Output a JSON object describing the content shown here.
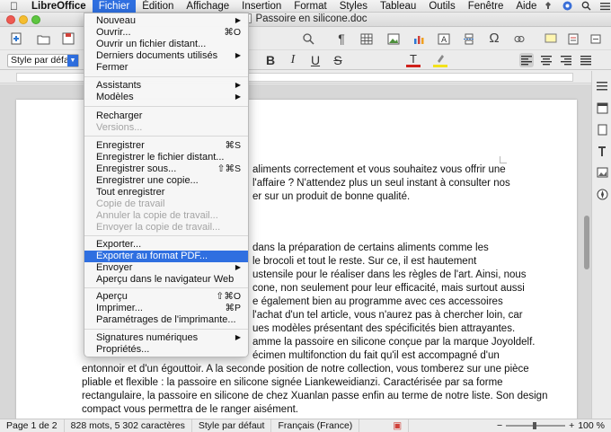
{
  "menubar": {
    "app_name": "LibreOffice",
    "items": [
      "Fichier",
      "Édition",
      "Affichage",
      "Insertion",
      "Format",
      "Styles",
      "Tableau",
      "Outils",
      "Fenêtre",
      "Aide"
    ]
  },
  "window": {
    "title": "Passoire en silicone.doc"
  },
  "toolbar": {
    "paragraph_style": "Style par défaut",
    "bold_label": "B",
    "italic_label": "I",
    "underline_label": "U",
    "font_color_label": "T",
    "strike_label": "S"
  },
  "file_menu": {
    "items": [
      {
        "label": "Nouveau",
        "shortcut": "",
        "submenu": true,
        "disabled": false
      },
      {
        "label": "Ouvrir...",
        "shortcut": "⌘O",
        "submenu": false,
        "disabled": false
      },
      {
        "label": "Ouvrir un fichier distant...",
        "shortcut": "",
        "submenu": false,
        "disabled": false
      },
      {
        "label": "Derniers documents utilisés",
        "shortcut": "",
        "submenu": true,
        "disabled": false
      },
      {
        "label": "Fermer",
        "shortcut": "",
        "submenu": false,
        "disabled": false
      },
      {
        "label": "Assistants",
        "shortcut": "",
        "submenu": true,
        "disabled": false
      },
      {
        "label": "Modèles",
        "shortcut": "",
        "submenu": true,
        "disabled": false
      },
      {
        "label": "Recharger",
        "shortcut": "",
        "submenu": false,
        "disabled": false
      },
      {
        "label": "Versions...",
        "shortcut": "",
        "submenu": false,
        "disabled": true
      },
      {
        "label": "Enregistrer",
        "shortcut": "⌘S",
        "submenu": false,
        "disabled": false
      },
      {
        "label": "Enregistrer le fichier distant...",
        "shortcut": "",
        "submenu": false,
        "disabled": false
      },
      {
        "label": "Enregistrer sous...",
        "shortcut": "⇧⌘S",
        "submenu": false,
        "disabled": false
      },
      {
        "label": "Enregistrer une copie...",
        "shortcut": "",
        "submenu": false,
        "disabled": false
      },
      {
        "label": "Tout enregistrer",
        "shortcut": "",
        "submenu": false,
        "disabled": false
      },
      {
        "label": "Copie de travail",
        "shortcut": "",
        "submenu": false,
        "disabled": true
      },
      {
        "label": "Annuler la copie de travail...",
        "shortcut": "",
        "submenu": false,
        "disabled": true
      },
      {
        "label": "Envoyer la copie de travail...",
        "shortcut": "",
        "submenu": false,
        "disabled": true
      },
      {
        "label": "Exporter...",
        "shortcut": "",
        "submenu": false,
        "disabled": false
      },
      {
        "label": "Exporter au format PDF...",
        "shortcut": "",
        "submenu": false,
        "disabled": false,
        "highlighted": true
      },
      {
        "label": "Envoyer",
        "shortcut": "",
        "submenu": true,
        "disabled": false
      },
      {
        "label": "Aperçu dans le navigateur Web",
        "shortcut": "",
        "submenu": false,
        "disabled": false
      },
      {
        "label": "Aperçu",
        "shortcut": "⇧⌘O",
        "submenu": false,
        "disabled": false
      },
      {
        "label": "Imprimer...",
        "shortcut": "⌘P",
        "submenu": false,
        "disabled": false
      },
      {
        "label": "Paramétrages de l'imprimante...",
        "shortcut": "",
        "submenu": false,
        "disabled": false
      },
      {
        "label": "Signatures numériques",
        "shortcut": "",
        "submenu": true,
        "disabled": false
      },
      {
        "label": "Propriétés...",
        "shortcut": "",
        "submenu": false,
        "disabled": false
      }
    ]
  },
  "document": {
    "lines_top": [
      "aliments correctement et vous souhaitez vous offrir une",
      "l'affaire ? N'attendez plus un seul instant à consulter nos",
      "er sur un produit de bonne qualité."
    ],
    "lines_mid": [
      "dans la préparation de certains aliments comme les",
      "le brocoli et tout le reste. Sur ce, il est hautement",
      "ustensile pour le réaliser dans les règles de l'art. Ainsi, nous",
      "cone, non seulement pour leur efficacité, mais surtout aussi",
      "e également bien au programme avec ces accessoires",
      "l'achat d'un tel article, vous n'aurez pas à chercher loin, car",
      "ues modèles présentant des spécificités bien attrayantes.",
      "amme la passoire en silicone conçue par la marque Joyoldelf.",
      "écimen multifonction du fait qu'il est accompagné d'un"
    ],
    "lines_full": [
      "entonnoir et d'un égouttoir. A la seconde position de notre collection, vous tomberez sur une pièce",
      "pliable et flexible : la passoire en silicone signée Liankeweidianzi. Caractérisée par sa forme",
      "rectangulaire, la passoire en silicone de chez Xuanlan passe enfin au terme de notre liste. Son design",
      "compact vous permettra de le ranger aisément."
    ]
  },
  "statusbar": {
    "page": "Page 1 de 2",
    "word_count": "828 mots, 5 302 caractères",
    "page_style": "Style par défaut",
    "language": "Français (France)",
    "zoom": "100 %"
  }
}
